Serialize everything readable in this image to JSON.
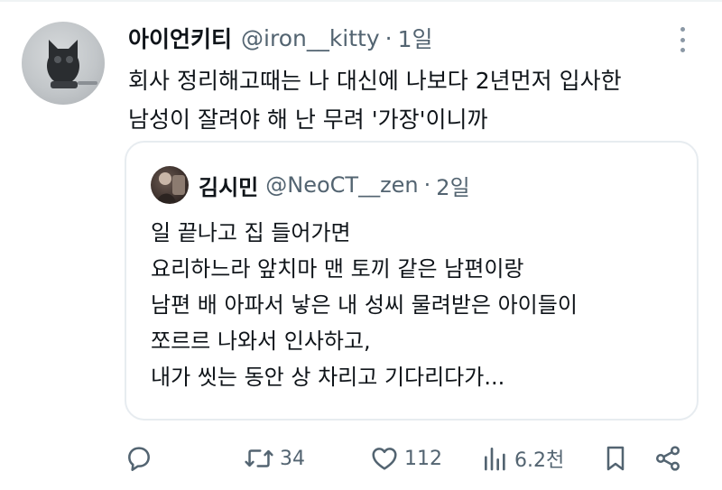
{
  "tweet": {
    "display_name": "아이언키티",
    "handle": "@iron__kitty",
    "separator": "·",
    "time": "1일",
    "text_lines": [
      "회사 정리해고때는 나 대신에 나보다 2년먼저 입사한",
      "남성이 잘려야 해 난 무려 '가장'이니까"
    ]
  },
  "quoted": {
    "display_name": "김시민",
    "handle": "@NeoCT__zen",
    "separator": "·",
    "time": "2일",
    "text_lines": [
      "일 끝나고 집 들어가면",
      "요리하느라 앞치마 맨 토끼 같은 남편이랑",
      "남편 배 아파서 낳은 내 성씨 물려받은 아이들이",
      "쪼르르 나와서 인사하고,",
      "내가 씻는 동안 상 차리고 기다리다가..."
    ]
  },
  "actions": {
    "reply_icon": "reply-icon",
    "retweet_icon": "retweet-icon",
    "retweet_count": "34",
    "like_icon": "heart-icon",
    "like_count": "112",
    "views_icon": "views-icon",
    "views_count": "6.2천",
    "bookmark_icon": "bookmark-icon",
    "share_icon": "share-icon"
  },
  "colors": {
    "text": "#0f1419",
    "muted": "#536471",
    "border": "#e7ecf0"
  }
}
